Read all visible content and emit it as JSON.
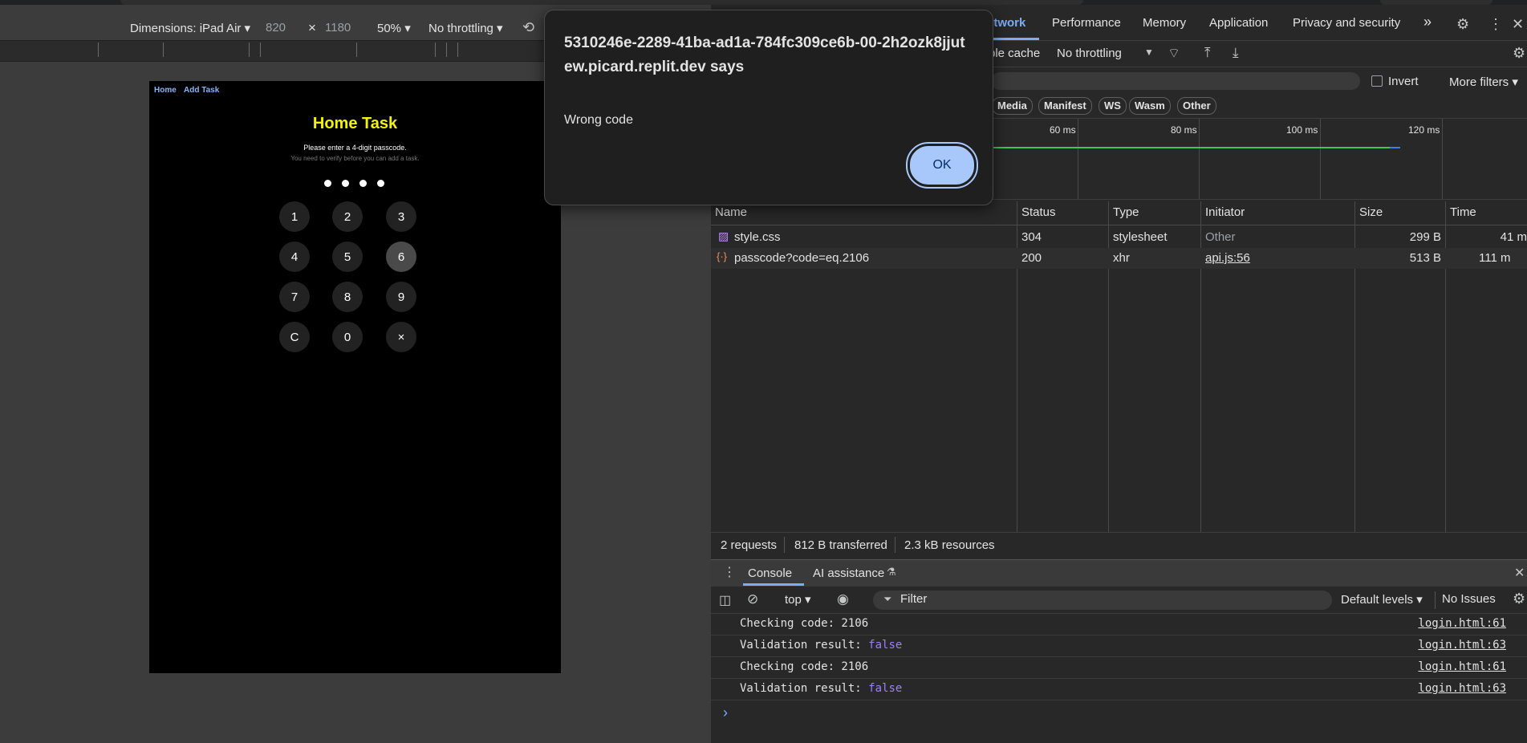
{
  "device_toolbar": {
    "dimensions_label": "Dimensions: iPad Air ▾",
    "width": "820",
    "times": "×",
    "height": "1180",
    "zoom": "50% ▾",
    "throttling": "No throttling ▾"
  },
  "page": {
    "nav": [
      "Home",
      "Add Task"
    ],
    "title": "Home Task",
    "prompt": "Please enter a 4-digit passcode.",
    "hint": "You need to verify before you can add a task.",
    "keypad": [
      "1",
      "2",
      "3",
      "4",
      "5",
      "6",
      "7",
      "8",
      "9",
      "C",
      "0",
      "×"
    ],
    "pressed_key": "6"
  },
  "devtools": {
    "tabs": [
      "etwork",
      "Performance",
      "Memory",
      "Application",
      "Privacy and security"
    ],
    "overflow": "»",
    "toolbar": {
      "disable_cache": "ble cache",
      "throttling": "No throttling"
    },
    "filter": {
      "invert": "Invert",
      "more_filters": "More filters ▾"
    },
    "chips": [
      "Media",
      "Manifest",
      "WS",
      "Wasm",
      "Other"
    ],
    "timeline_labels": [
      "60 ms",
      "80 ms",
      "100 ms",
      "120 ms"
    ],
    "columns": [
      "Name",
      "Status",
      "Type",
      "Initiator",
      "Size",
      "Time"
    ],
    "rows": [
      {
        "name": "style.css",
        "status": "304",
        "type": "stylesheet",
        "initiator": "Other",
        "size": "299 B",
        "time": "41 m"
      },
      {
        "name": "passcode?code=eq.2106",
        "status": "200",
        "type": "xhr",
        "initiator": "api.js:56",
        "size": "513 B",
        "time": "111 m"
      }
    ],
    "summary": [
      "2 requests",
      "812 B transferred",
      "2.3 kB resources"
    ],
    "drawer_tabs": [
      "Console",
      "AI assistance"
    ],
    "console_toolbar": {
      "context": "top ▾",
      "filter_placeholder": "Filter",
      "levels": "Default levels ▾",
      "issues": "No Issues"
    },
    "console_lines": [
      {
        "text": "Checking code: 2106",
        "value": "",
        "source": "login.html:61"
      },
      {
        "text": "Validation result: ",
        "value": "false",
        "source": "login.html:63"
      },
      {
        "text": "Checking code: 2106",
        "value": "",
        "source": "login.html:61"
      },
      {
        "text": "Validation result: ",
        "value": "false",
        "source": "login.html:63"
      }
    ],
    "prompt": "›"
  },
  "alert": {
    "origin": "5310246e-2289-41ba-ad1a-784fc309ce6b-00-2h2ozk8jjutew.picard.replit.dev says",
    "message": "Wrong code",
    "ok": "OK"
  }
}
